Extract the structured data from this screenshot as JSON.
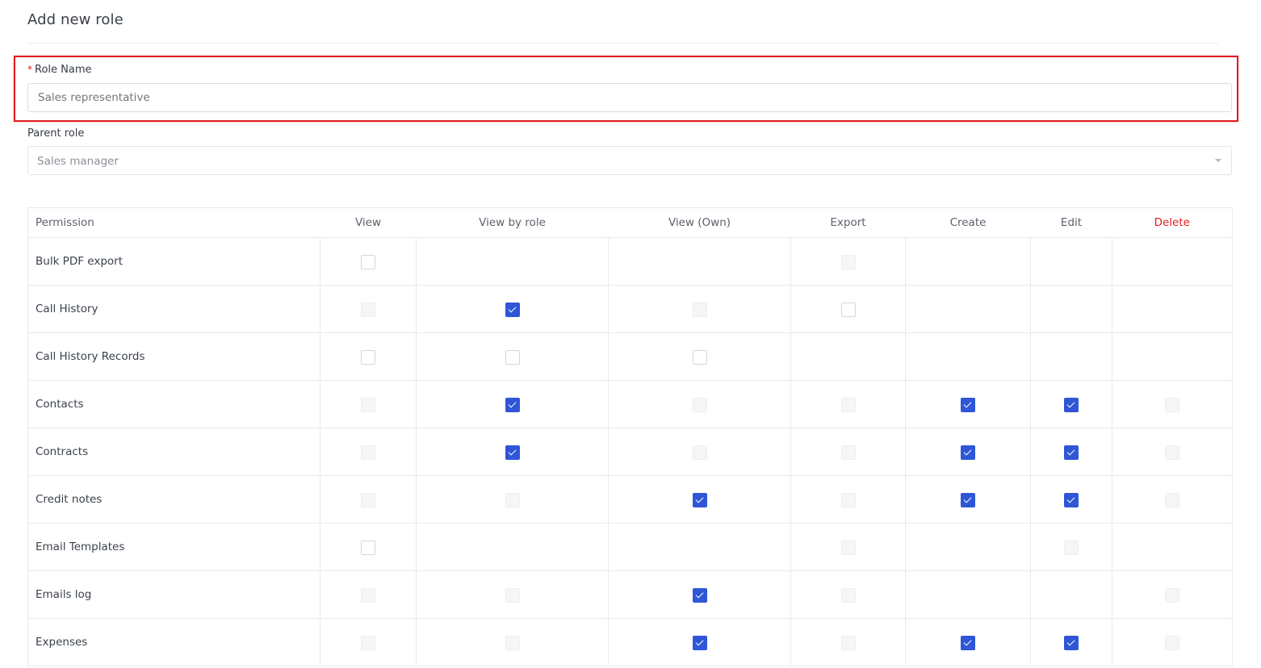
{
  "page": {
    "title": "Add new role"
  },
  "role_name": {
    "label": "Role Name",
    "required_marker": "*",
    "placeholder": "Sales representative"
  },
  "parent_role": {
    "label": "Parent role",
    "selected": "Sales manager"
  },
  "colors": {
    "accent": "#2f56d6",
    "danger": "#e11d22",
    "border": "#e8eaee"
  },
  "table": {
    "columns": [
      "Permission",
      "View",
      "View by role",
      "View (Own)",
      "Export",
      "Create",
      "Edit",
      "Delete"
    ],
    "rows": [
      {
        "name": "Bulk PDF export",
        "cells": [
          "unchecked",
          "none",
          "none",
          "disabled",
          "none",
          "none",
          "none"
        ]
      },
      {
        "name": "Call History",
        "cells": [
          "disabled",
          "checked",
          "disabled",
          "unchecked",
          "none",
          "none",
          "none"
        ]
      },
      {
        "name": "Call History Records",
        "cells": [
          "unchecked",
          "unchecked",
          "unchecked",
          "none",
          "none",
          "none",
          "none"
        ]
      },
      {
        "name": "Contacts",
        "cells": [
          "disabled",
          "checked",
          "disabled",
          "disabled",
          "checked",
          "checked",
          "disabled"
        ]
      },
      {
        "name": "Contracts",
        "cells": [
          "disabled",
          "checked",
          "disabled",
          "disabled",
          "checked",
          "checked",
          "disabled"
        ]
      },
      {
        "name": "Credit notes",
        "cells": [
          "disabled",
          "disabled",
          "checked",
          "disabled",
          "checked",
          "checked",
          "disabled"
        ]
      },
      {
        "name": "Email Templates",
        "cells": [
          "unchecked",
          "none",
          "none",
          "disabled",
          "none",
          "disabled",
          "none"
        ]
      },
      {
        "name": "Emails log",
        "cells": [
          "disabled",
          "disabled",
          "checked",
          "disabled",
          "none",
          "none",
          "disabled"
        ]
      },
      {
        "name": "Expenses",
        "cells": [
          "disabled",
          "disabled",
          "checked",
          "disabled",
          "checked",
          "checked",
          "disabled"
        ]
      }
    ]
  }
}
